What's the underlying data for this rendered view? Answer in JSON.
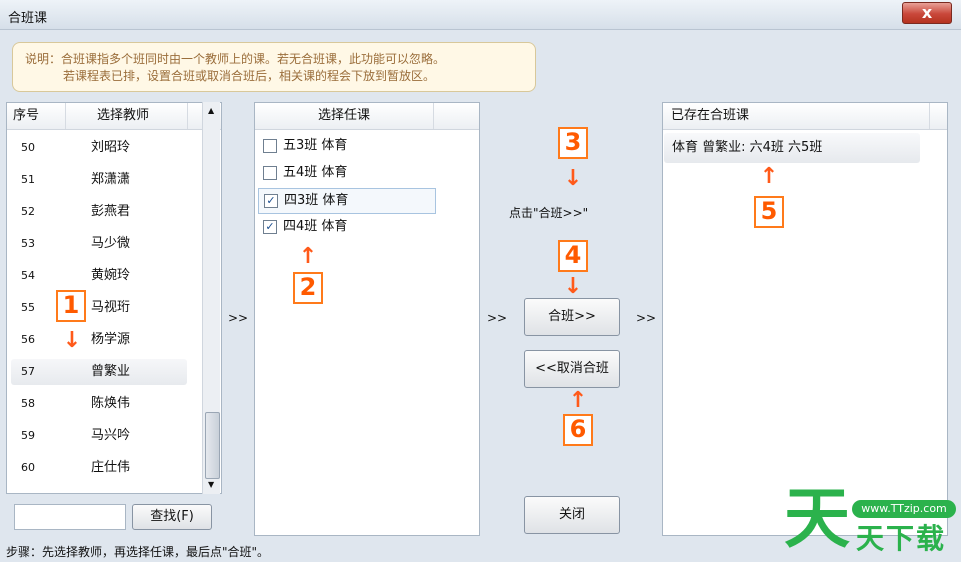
{
  "window": {
    "title": "合班课",
    "close_glyph": "x"
  },
  "info": {
    "line1": "说明：合班课指多个班同时由一个教师上的课。若无合班课，此功能可以忽略。",
    "line2": "若课程表已排，设置合班或取消合班后，相关课的程会下放到暂放区。"
  },
  "teachers": {
    "col_num": "序号",
    "col_name": "选择教师",
    "rows": [
      {
        "num": "50",
        "name": "刘昭玲"
      },
      {
        "num": "51",
        "name": "郑潇潇"
      },
      {
        "num": "52",
        "name": "彭燕君"
      },
      {
        "num": "53",
        "name": "马少微"
      },
      {
        "num": "54",
        "name": "黄婉玲"
      },
      {
        "num": "55",
        "name": "马视珩"
      },
      {
        "num": "56",
        "name": "杨学源"
      },
      {
        "num": "57",
        "name": "曾繁业"
      },
      {
        "num": "58",
        "name": "陈焕伟"
      },
      {
        "num": "59",
        "name": "马兴吟"
      },
      {
        "num": "60",
        "name": "庄仕伟"
      }
    ],
    "selected_index": 7,
    "search_value": "",
    "find_label": "查找(F)"
  },
  "courses": {
    "header": "选择任课",
    "items": [
      {
        "label": "五3班 体育",
        "checked": false,
        "check_glyph": ""
      },
      {
        "label": "五4班 体育",
        "checked": false,
        "check_glyph": ""
      },
      {
        "label": "四3班 体育",
        "checked": true,
        "check_glyph": "✓"
      },
      {
        "label": "四4班 体育",
        "checked": true,
        "check_glyph": "✓"
      }
    ]
  },
  "arrows": {
    "a1": ">>",
    "a2": ">>",
    "a3": ">>"
  },
  "actions": {
    "hint": "点击\"合班>>\"",
    "merge_label": "合班>>",
    "cancel_label": "<<取消合班",
    "close_label": "关闭"
  },
  "existing": {
    "header": "已存在合班课",
    "items": [
      "体育 曾繁业: 六4班 六5班"
    ]
  },
  "annotations": {
    "n1": "1",
    "n2": "2",
    "n3": "3",
    "n4": "4",
    "n5": "5",
    "n6": "6"
  },
  "status": {
    "text": "步骤：先选择教师，再选择任课，最后点\"合班\"。"
  },
  "watermark": {
    "url": "www.TTzip.com",
    "glyph": "天",
    "name": "天下载"
  },
  "colors": {
    "annotation": "#ff7a1a",
    "brand_green": "#2bb24c",
    "close_red": "#c9473a"
  }
}
